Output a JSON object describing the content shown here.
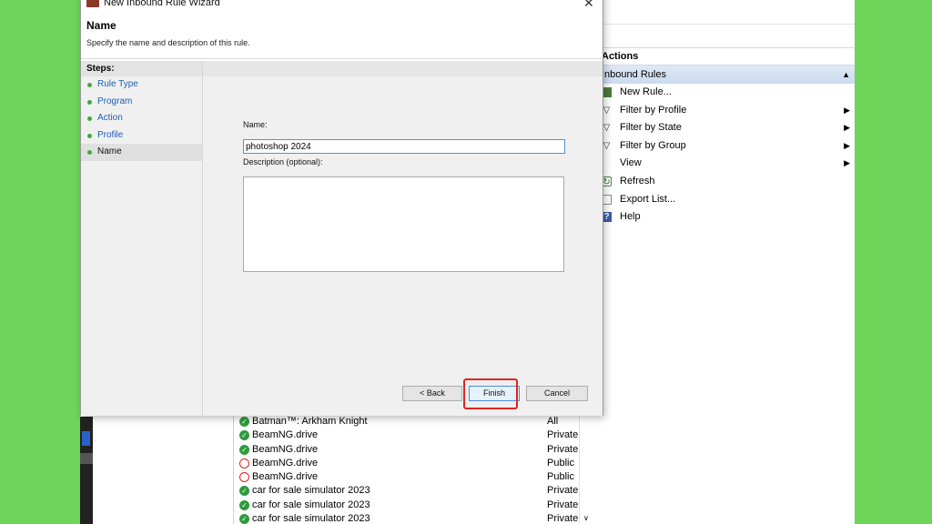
{
  "wizard": {
    "title": "New Inbound Rule Wizard",
    "heading": "Name",
    "subtitle": "Specify the name and description of this rule.",
    "close_glyph": "✕",
    "steps_title": "Steps:",
    "steps": [
      {
        "label": "Rule Type"
      },
      {
        "label": "Program"
      },
      {
        "label": "Action"
      },
      {
        "label": "Profile"
      },
      {
        "label": "Name",
        "current": true
      }
    ],
    "name_label": "Name:",
    "name_value": "photoshop 2024",
    "description_label": "Description (optional):",
    "description_value": "",
    "buttons": {
      "back": "< Back",
      "finish": "Finish",
      "cancel": "Cancel"
    }
  },
  "actions_pane": {
    "title": "Actions",
    "section": "Inbound Rules",
    "items": [
      {
        "label": "New Rule...",
        "icon": "new-rule-icon",
        "submenu": false
      },
      {
        "label": "Filter by Profile",
        "icon": "filter-icon",
        "submenu": true
      },
      {
        "label": "Filter by State",
        "icon": "filter-icon",
        "submenu": true
      },
      {
        "label": "Filter by Group",
        "icon": "filter-icon",
        "submenu": true
      },
      {
        "label": "View",
        "icon": "",
        "submenu": true
      },
      {
        "label": "Refresh",
        "icon": "refresh-icon",
        "submenu": false
      },
      {
        "label": "Export List...",
        "icon": "export-list-icon",
        "submenu": false
      },
      {
        "label": "Help",
        "icon": "help-icon",
        "submenu": false
      }
    ]
  },
  "rules": [
    {
      "name": "Batman™: Arkham Knight",
      "profile": "All",
      "status": "allow"
    },
    {
      "name": "BeamNG.drive",
      "profile": "Private",
      "status": "allow"
    },
    {
      "name": "BeamNG.drive",
      "profile": "Private",
      "status": "allow"
    },
    {
      "name": "BeamNG.drive",
      "profile": "Public",
      "status": "block"
    },
    {
      "name": "BeamNG.drive",
      "profile": "Public",
      "status": "block"
    },
    {
      "name": "car for sale simulator 2023",
      "profile": "Private",
      "status": "allow"
    },
    {
      "name": "car for sale simulator 2023",
      "profile": "Private",
      "status": "allow"
    },
    {
      "name": "car for sale simulator 2023",
      "profile": "Private",
      "status": "allow"
    }
  ],
  "colors": {
    "outer_background": "#6fd45a",
    "highlight_border": "#e02424",
    "step_link": "#1e5fb3",
    "allow_icon": "#2e9a3c",
    "block_icon": "#d22222"
  }
}
